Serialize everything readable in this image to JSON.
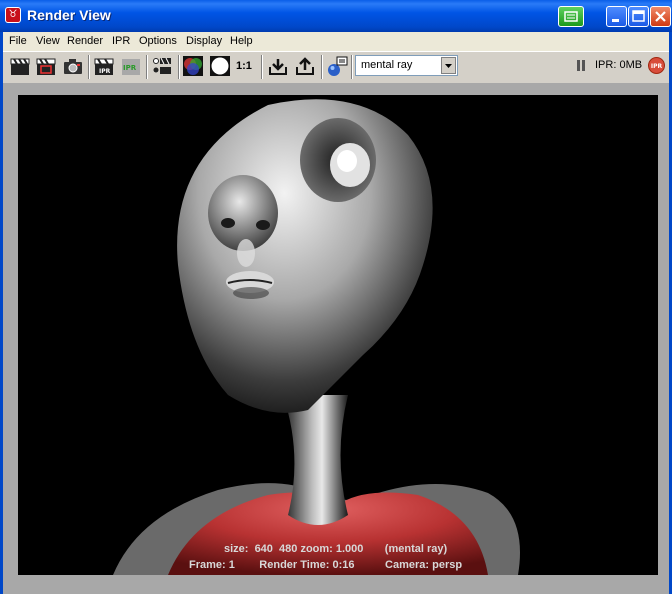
{
  "window": {
    "title": "Render View"
  },
  "menu": [
    "File",
    "View",
    "Render",
    "IPR",
    "Options",
    "Display",
    "Help"
  ],
  "toolbar": {
    "ratio_label": "1:1",
    "renderer": "mental ray",
    "ipr_memory": "IPR: 0MB",
    "ipr_badge": "IPR",
    "icons": [
      "clapper-render-icon",
      "clapper-region-icon",
      "snapshot-camera-icon",
      "ipr-render-icon",
      "ipr-refresh-icon",
      "render-settings-icon",
      "rgb-channel-icon",
      "alpha-channel-icon",
      "keep-image-icon",
      "remove-image-icon",
      "render-globals-icon"
    ]
  },
  "image_info": {
    "line1": "size:  640  480 zoom: 1.000       (mental ray)",
    "line2": "Frame: 1        Render Time: 0:16          Camera: persp"
  },
  "colors": {
    "titlebar": "#0055e5",
    "chrome": "#d4d0c8",
    "shirt": "#c03a3a"
  }
}
